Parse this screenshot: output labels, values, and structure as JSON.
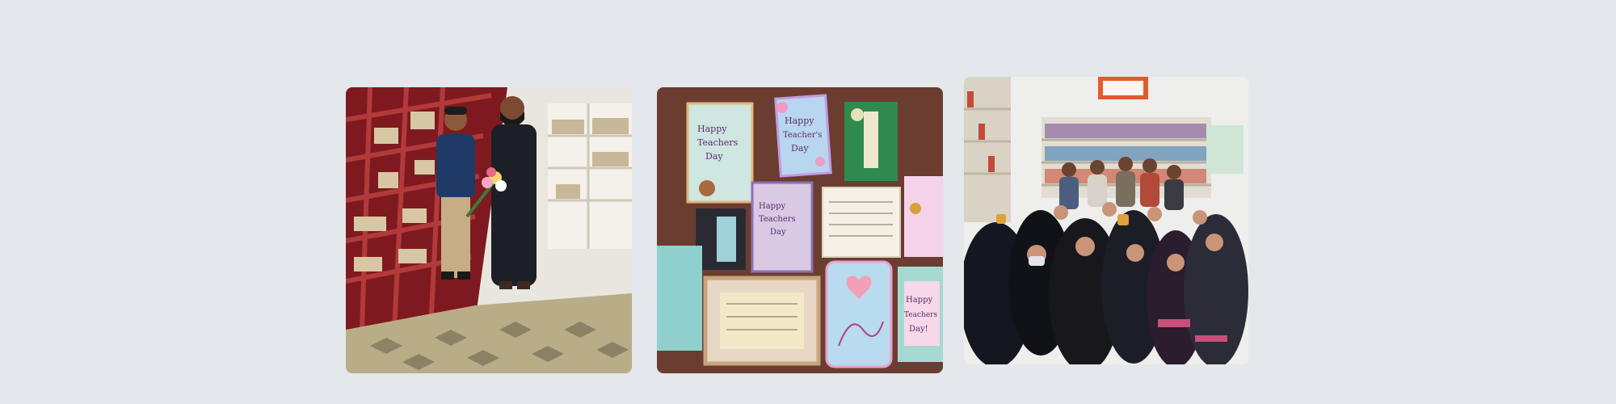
{
  "gallery": {
    "photos": [
      {
        "card_text": []
      },
      {
        "card_text": [
          "Happy",
          "Teachers",
          "Day",
          "Happy",
          "Teacher's",
          "Day",
          "Happy",
          "Teachers",
          "Day",
          "Happy",
          "Teachers",
          "Day!"
        ]
      },
      {
        "card_text": []
      }
    ]
  }
}
